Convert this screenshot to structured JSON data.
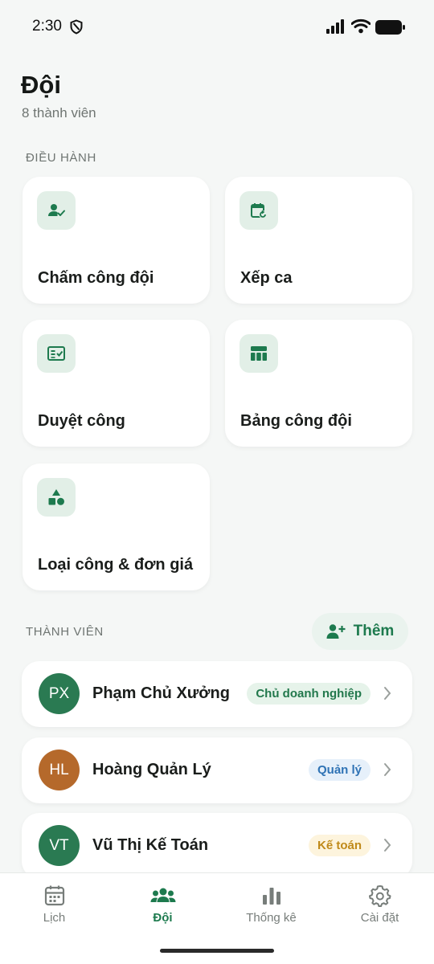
{
  "status_bar": {
    "time": "2:30"
  },
  "header": {
    "title": "Đội",
    "subtitle": "8 thành viên"
  },
  "operations": {
    "section_label": "ĐIỀU HÀNH",
    "items": [
      {
        "label": "Chấm công đội",
        "icon": "person-check-icon"
      },
      {
        "label": "Xếp ca",
        "icon": "calendar-refresh-icon"
      },
      {
        "label": "Duyệt công",
        "icon": "checklist-icon"
      },
      {
        "label": "Bảng công đội",
        "icon": "table-icon"
      },
      {
        "label": "Loại công & đơn giá",
        "icon": "shapes-icon"
      }
    ]
  },
  "members": {
    "section_label": "THÀNH VIÊN",
    "add_label": "Thêm",
    "items": [
      {
        "initials": "PX",
        "name": "Phạm Chủ Xưởng",
        "role": "Chủ doanh nghiệp",
        "avatar_color": "#2a7a52",
        "badge_bg": "#e6f3ea",
        "badge_fg": "#22784c"
      },
      {
        "initials": "HL",
        "name": "Hoàng Quản Lý",
        "role": "Quản lý",
        "avatar_color": "#b5692b",
        "badge_bg": "#e6f0fa",
        "badge_fg": "#2f73b5"
      },
      {
        "initials": "VT",
        "name": "Vũ Thị Kế Toán",
        "role": "Kế toán",
        "avatar_color": "#2a7a52",
        "badge_bg": "#fdf4dd",
        "badge_fg": "#c08a1a"
      }
    ]
  },
  "bottom_nav": {
    "items": [
      {
        "label": "Lịch",
        "icon": "calendar-icon",
        "active": false
      },
      {
        "label": "Đội",
        "icon": "team-icon",
        "active": true
      },
      {
        "label": "Thống kê",
        "icon": "bar-chart-icon",
        "active": false
      },
      {
        "label": "Cài đặt",
        "icon": "gear-icon",
        "active": false
      }
    ]
  },
  "colors": {
    "accent": "#1d7a4e",
    "background": "#f5f7f6"
  }
}
